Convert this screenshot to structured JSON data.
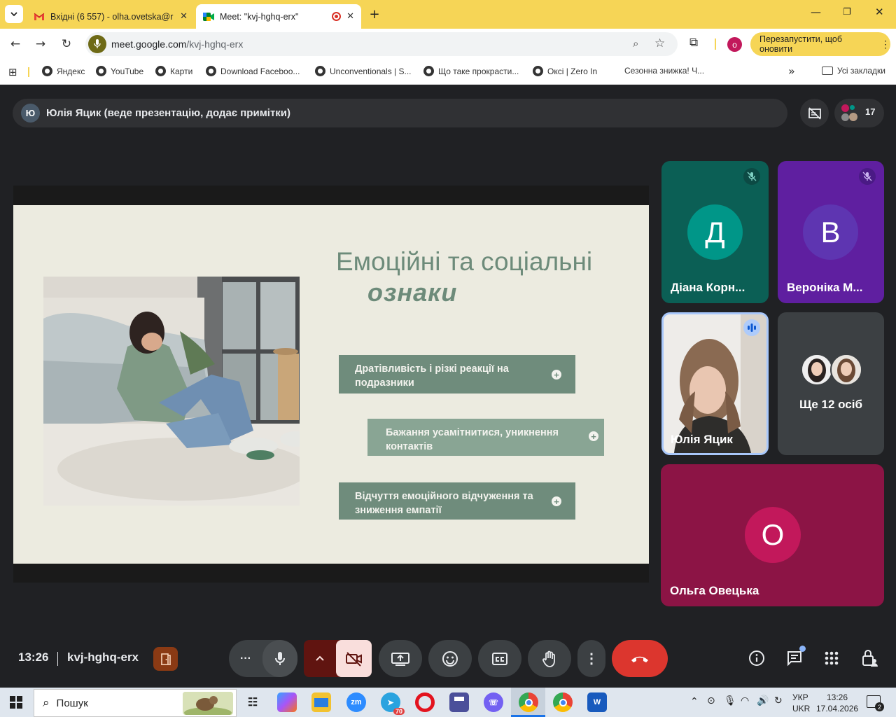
{
  "browser": {
    "tabs": [
      {
        "title": "Вхідні (6 557) - olha.ovetska@r",
        "icon": "gmail-icon"
      },
      {
        "title": "Meet: \"kvj-hghq-erx\"",
        "icon": "meet-icon",
        "active": true
      }
    ],
    "url_host": "meet.google.com",
    "url_path": "/kvj-hghq-erx",
    "profile_initial": "o",
    "update_label": "Перезапустити, щоб оновити",
    "bookmarks": [
      "Яндекс",
      "YouTube",
      "Карти",
      "Download Faceboo...",
      "Unconventionals | S...",
      "Що таке прокрасти...",
      "Оксі | Zero In",
      "Сезонна знижка! Ч..."
    ],
    "all_bookmarks_label": "Усі закладки"
  },
  "meet": {
    "presenter_initial": "Ю",
    "presenter_text": "Юлія Яцик (веде презентацію, додає примітки)",
    "participant_count": "17",
    "slide": {
      "title": "Емоційні та соціальні",
      "subtitle": "ознаки",
      "points": [
        "Дратівливість і різкі реакції на подразники",
        "Бажання усамітнитися, уникнення контактів",
        "Відчуття емоційного відчуження та зниження емпатії"
      ]
    },
    "tiles": [
      {
        "initial": "Д",
        "name": "Діана Корн...",
        "bg": "#0b5f55",
        "avatar": "#009688",
        "muted": true
      },
      {
        "initial": "В",
        "name": "Вероніка М...",
        "bg": "#5f1fa0",
        "avatar": "#5e35b1",
        "muted": true
      },
      {
        "name": "Юлія Яцик",
        "speaking": true
      },
      {
        "name": "Ще 12 осіб"
      },
      {
        "initial": "О",
        "name": "Ольга Овецька",
        "bg": "#8c1445",
        "avatar": "#c2185b"
      }
    ],
    "time": "13:26",
    "meeting_code": "kvj-hghq-erx"
  },
  "taskbar": {
    "search_placeholder": "Пошук",
    "lang_top": "УКР",
    "lang_bottom": "UKR",
    "time": "13:26",
    "date": "17.04.2026",
    "telegram_badge": "70",
    "notifications": "2"
  }
}
